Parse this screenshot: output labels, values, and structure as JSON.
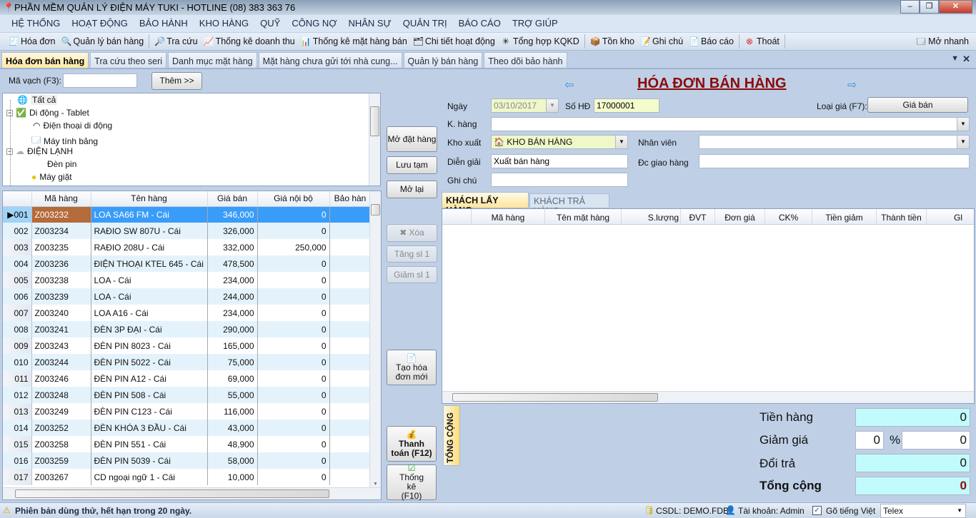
{
  "window": {
    "title": "PHẦN MỀM QUẢN LÝ ĐIỆN MÁY TUKI - HOTLINE (08) 383 363 76",
    "controls": [
      "minimize",
      "restore",
      "close"
    ]
  },
  "menu": [
    "HỆ THỐNG",
    "HOẠT ĐỘNG",
    "BẢO HÀNH",
    "KHO HÀNG",
    "QUỸ",
    "CÔNG NỢ",
    "NHÂN SỰ",
    "QUẢN TRỊ",
    "BÁO CÁO",
    "TRỢ GIÚP"
  ],
  "toolbar": [
    {
      "label": "Hóa đơn",
      "icon": "invoice-icon"
    },
    {
      "label": "Quản lý bán hàng",
      "icon": "sales-manage-icon"
    },
    {
      "label": "Tra cứu",
      "icon": "search-icon"
    },
    {
      "label": "Thống kê doanh thu",
      "icon": "revenue-chart-icon"
    },
    {
      "label": "Thống kê mặt hàng bán",
      "icon": "bar-chart-icon"
    },
    {
      "label": "Chi tiết hoạt động",
      "icon": "activity-icon"
    },
    {
      "label": "Tổng hợp KQKD",
      "icon": "summary-icon"
    },
    {
      "label": "Tồn kho",
      "icon": "stock-boxes-icon"
    },
    {
      "label": "Ghi chú",
      "icon": "note-icon"
    },
    {
      "label": "Báo cáo",
      "icon": "report-icon"
    },
    {
      "label": "Thoát",
      "icon": "exit-icon"
    }
  ],
  "quick_open": "Mở nhanh",
  "doc_tabs": [
    "Hóa đơn bán hàng",
    "Tra cứu theo seri",
    "Danh mục mặt hàng",
    "Mặt hàng chưa gửi tới nhà cung...",
    "Quản lý bán hàng",
    "Theo dõi bảo hành"
  ],
  "barcode": {
    "label": "Mã vạch (F3):",
    "value": "",
    "add_button": "Thêm >>"
  },
  "tree": [
    "Tất cả",
    "Di động - Tablet",
    "Điện thoại di động",
    "Máy tính bảng",
    "ĐIỆN LẠNH",
    "Đèn pin",
    "Máy giặt"
  ],
  "products": {
    "columns": [
      "Mã hàng",
      "Tên hàng",
      "Giá bán",
      "Giá nội bộ",
      "Bảo hàn"
    ],
    "rows": [
      [
        "001",
        "Z003232",
        "LOA SA66 FM - Cái",
        "346,000",
        "0"
      ],
      [
        "002",
        "Z003234",
        "RAĐIO SW 807U - Cái",
        "326,000",
        "0"
      ],
      [
        "003",
        "Z003235",
        "RAĐIO 208U - Cái",
        "332,000",
        "250,000"
      ],
      [
        "004",
        "Z003236",
        "ĐIỆN THOẠI KTEL 645 - Cái",
        "478,500",
        "0"
      ],
      [
        "005",
        "Z003238",
        "LOA - Cái",
        "234,000",
        "0"
      ],
      [
        "006",
        "Z003239",
        "LOA - Cái",
        "244,000",
        "0"
      ],
      [
        "007",
        "Z003240",
        "LOA A16 - Cái",
        "234,000",
        "0"
      ],
      [
        "008",
        "Z003241",
        "ĐÈN 3P ĐẠI - Cái",
        "290,000",
        "0"
      ],
      [
        "009",
        "Z003243",
        "ĐÈN PIN 8023 - Cái",
        "165,000",
        "0"
      ],
      [
        "010",
        "Z003244",
        "ĐÈN PIN 5022 - Cái",
        "75,000",
        "0"
      ],
      [
        "011",
        "Z003246",
        "ĐÈN PIN A12 - Cái",
        "69,000",
        "0"
      ],
      [
        "012",
        "Z003248",
        "ĐÈN PIN 508 - Cái",
        "55,000",
        "0"
      ],
      [
        "013",
        "Z003249",
        "ĐÈN PIN C123 - Cái",
        "116,000",
        "0"
      ],
      [
        "014",
        "Z003252",
        "ĐÈN KHÓA 3 ĐẦU - Cái",
        "43,000",
        "0"
      ],
      [
        "015",
        "Z003258",
        "ĐÈN PIN 551 - Cái",
        "48,900",
        "0"
      ],
      [
        "016",
        "Z003259",
        "ĐÈN PIN 5039 - Cái",
        "58,000",
        "0"
      ],
      [
        "017",
        "Z003267",
        "CD ngoại ngữ 1 - Cái",
        "10,000",
        "0"
      ]
    ]
  },
  "actions": {
    "open_order": "Mở đặt hàng",
    "save_draft": "Lưu tạm",
    "reopen": "Mở lại",
    "delete": "Xóa",
    "increase": "Tăng sl 1",
    "decrease": "Giảm sl 1",
    "new_invoice": "Tạo hóa đơn mới",
    "pay": "Thanh toán (F12)",
    "stats": "Thống kê (F10)"
  },
  "invoice": {
    "title": "HÓA ĐƠN BÁN HÀNG",
    "date_label": "Ngày",
    "date": "03/10/2017",
    "no_label": "Số HĐ",
    "no": "17000001",
    "price_type_label": "Loại giá (F7):",
    "price_type": "Giá bán",
    "customer_label": "K. hàng",
    "customer": "",
    "warehouse_label": "Kho xuất",
    "warehouse": "KHO BÁN HÀNG",
    "staff_label": "Nhân viên",
    "staff": "",
    "desc_label": "Diễn giải",
    "desc": "Xuất bán hàng",
    "address_label": "Đc giao hàng",
    "address": "",
    "note_label": "Ghi chú",
    "note": "",
    "tabs": [
      "KHÁCH LẤY HÀNG",
      "KHÁCH TRẢ HÀNG"
    ],
    "columns": [
      "Mã hàng",
      "Tên mặt hàng",
      "S.lượng",
      "ĐVT",
      "Đơn giá",
      "CK%",
      "Tiền giảm",
      "Thành tiền",
      "Gl"
    ]
  },
  "totals": {
    "tab": "TỔNG CỘNG",
    "goods_label": "Tiền hàng",
    "goods": "0",
    "discount_label": "Giảm giá",
    "discount_pct": "0",
    "pct_sign": "%",
    "discount": "0",
    "return_label": "Đổi trả",
    "return": "0",
    "total_label": "Tổng cộng",
    "total": "0"
  },
  "status": {
    "trial": "Phiên bản dùng thử, hết hạn trong 20 ngày.",
    "db": "CSDL: DEMO.FDB",
    "account": "Tài khoản: Admin",
    "vietnamese_label": "Gõ tiếng Việt",
    "vietnamese_checked": true,
    "input_method": "Telex"
  }
}
